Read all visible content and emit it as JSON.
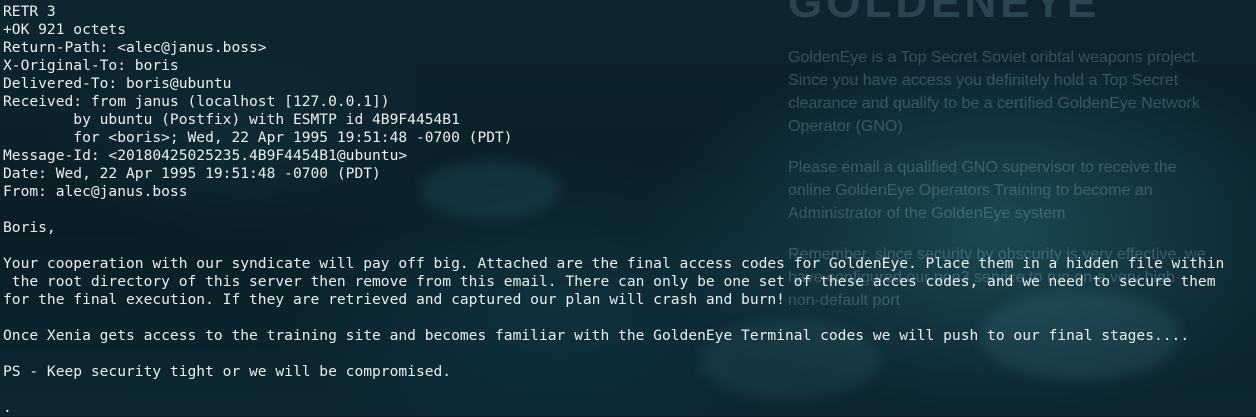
{
  "background": {
    "site_title": "GOLDENEYE",
    "paragraphs": [
      "GoldenEye is a Top Secret Soviet oribtal weapons project. Since you have access you definitely hold a Top Secret clearance and qualify to be a certified GoldenEye Network Operator (GNO)",
      "Please email a qualified GNO supervisor to receive the online GoldenEye Operators Training to become an Administrator of the GoldenEye system",
      "Remember, since security by obscurity is very effective, we have configured our pop3 service to run on a very high non-default port"
    ]
  },
  "terminal": {
    "colors": {
      "text": "#e9eef0",
      "background": "#0b1a22"
    },
    "lines": [
      "RETR 3",
      "+OK 921 octets",
      "Return-Path: <alec@janus.boss>",
      "X-Original-To: boris",
      "Delivered-To: boris@ubuntu",
      "Received: from janus (localhost [127.0.0.1])",
      "        by ubuntu (Postfix) with ESMTP id 4B9F4454B1",
      "        for <boris>; Wed, 22 Apr 1995 19:51:48 -0700 (PDT)",
      "Message-Id: <20180425025235.4B9F4454B1@ubuntu>",
      "Date: Wed, 22 Apr 1995 19:51:48 -0700 (PDT)",
      "From: alec@janus.boss",
      "",
      "Boris,",
      "",
      "Your cooperation with our syndicate will pay off big. Attached are the final access codes for GoldenEye. Place them in a hidden file within",
      " the root directory of this server then remove from this email. There can only be one set of these acces codes, and we need to secure them",
      "for the final execution. If they are retrieved and captured our plan will crash and burn!",
      "",
      "Once Xenia gets access to the training site and becomes familiar with the GoldenEye Terminal codes we will push to our final stages....",
      "",
      "PS - Keep security tight or we will be compromised.",
      "",
      "."
    ]
  }
}
